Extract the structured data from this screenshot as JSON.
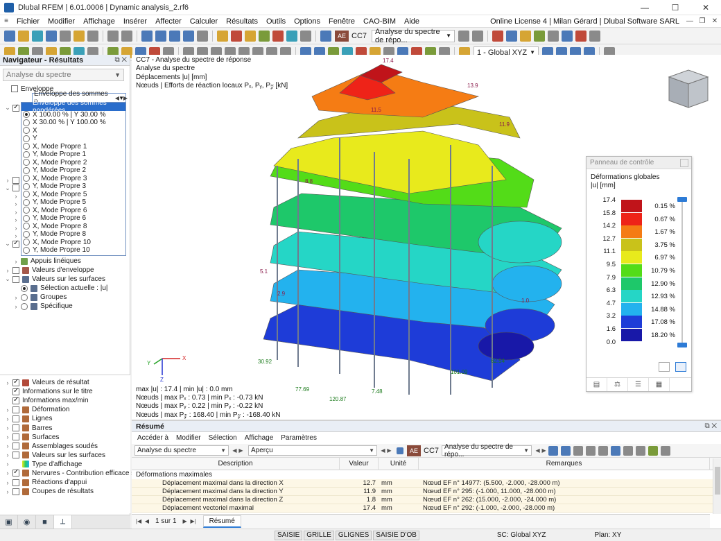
{
  "window": {
    "title": "Dlubal RFEM | 6.01.0006 | Dynamic analysis_2.rf6",
    "minimize": "—",
    "maximize": "☐",
    "close": "✕"
  },
  "menu": {
    "items": [
      "Fichier",
      "Modifier",
      "Affichage",
      "Insérer",
      "Affecter",
      "Calculer",
      "Résultats",
      "Outils",
      "Options",
      "Fenêtre",
      "CAO-BIM",
      "Aide"
    ],
    "license": "Online License 4 | Milan Gérard | Dlubal Software SARL"
  },
  "toolbar": {
    "lc_badge": "AE",
    "lc_code": "CC7",
    "lc_name": "Analyse du spectre de répo...",
    "view_combo": "1 - Global XYZ"
  },
  "navigator": {
    "title": "Navigateur - Résultats",
    "analysis_combo": "Analyse du spectre",
    "enveloppe_label": "Enveloppe",
    "enveloppe_dropdown": "Enveloppe des sommes p...",
    "dropdown_selected": "Enveloppe des sommes pondérées",
    "dropdown_items": [
      "X 100.00 % | Y 30.00 %",
      "X 30.00 % | Y 100.00 %",
      "X",
      "Y",
      "X, Mode Propre 1",
      "Y, Mode Propre 1",
      "X, Mode Propre 2",
      "Y, Mode Propre 2",
      "X, Mode Propre 3",
      "Y, Mode Propre 3",
      "X, Mode Propre 5",
      "Y, Mode Propre 5",
      "X, Mode Propre 6",
      "Y, Mode Propre 6",
      "X, Mode Propre 8",
      "Y, Mode Propre 8",
      "X, Mode Propre 10",
      "Y, Mode Propre 10"
    ],
    "tree_items": [
      "Appuis linéiques",
      "Valeurs d'enveloppe",
      "Valeurs sur les surfaces",
      "Sélection actuelle : |u|",
      "Groupes",
      "Spécifique"
    ],
    "bottom_items": [
      "Valeurs de résultat",
      "Informations sur le titre",
      "Informations max/min",
      "Déformation",
      "Lignes",
      "Barres",
      "Surfaces",
      "Assemblages soudés",
      "Valeurs sur les surfaces",
      "Type d'affichage",
      "Nervures - Contribution efficace sur ...",
      "Réactions d'appui",
      "Coupes de résultats"
    ],
    "tabs": [
      "camera-icon",
      "eye-icon",
      "video-icon",
      "axis-icon"
    ]
  },
  "viewport": {
    "info": [
      "CC7 - Analyse du spectre de réponse",
      "Analyse du spectre",
      "Déplacements |u| [mm]",
      "Nœuds | Efforts de réaction locaux Pₓ, Pᵧ, P𝓏 [kN]"
    ],
    "summary": [
      "max |u| : 17.4 | min |u| : 0.0 mm",
      "Nœuds | max Pₓ : 0.73 | min Pₓ : -0.73 kN",
      "Nœuds | max Pᵧ : 0.22 | min Pᵧ : -0.22 kN",
      "Nœuds | max P𝓏 : 168.40 | min P𝓏 : -168.40 kN"
    ],
    "labels_top": [
      "17.4",
      "13.9",
      "11.9",
      "11.5",
      "8.8",
      "5.1",
      "2.9",
      "1.0"
    ],
    "labels_reaction": [
      "30.92",
      "77.69",
      "120.87",
      "101.09",
      "62.54",
      "7.48"
    ],
    "axis": {
      "x": "X",
      "y": "Y",
      "z": "Z"
    }
  },
  "control_panel": {
    "title": "Panneau de contrôle",
    "subtitle_1": "Déformations globales",
    "subtitle_2": "|u| [mm]",
    "legend": [
      {
        "value": "17.4",
        "color": "#c0141a",
        "pct": "0.15 %"
      },
      {
        "value": "15.8",
        "color": "#ee2318",
        "pct": "0.67 %"
      },
      {
        "value": "14.2",
        "color": "#f57c14",
        "pct": "1.67 %"
      },
      {
        "value": "12.7",
        "color": "#c9c21a",
        "pct": "3.75 %"
      },
      {
        "value": "11.1",
        "color": "#e8ea1c",
        "pct": "6.97 %"
      },
      {
        "value": "9.5",
        "color": "#53dc18",
        "pct": "10.79 %"
      },
      {
        "value": "7.9",
        "color": "#1ec86a",
        "pct": "12.90 %"
      },
      {
        "value": "6.3",
        "color": "#25d6c6",
        "pct": "12.93 %"
      },
      {
        "value": "4.7",
        "color": "#23b2ee",
        "pct": "14.88 %"
      },
      {
        "value": "3.2",
        "color": "#1e3cd8",
        "pct": "17.08 %"
      },
      {
        "value": "1.6",
        "color": "#1818a8",
        "pct": "18.20 %"
      }
    ],
    "legend_min": "0.0"
  },
  "resume": {
    "title": "Résumé",
    "menu": [
      "Accéder à",
      "Modifier",
      "Sélection",
      "Affichage",
      "Paramètres"
    ],
    "combo_analysis": "Analyse du spectre",
    "combo_view": "Aperçu",
    "lc_badge": "AE",
    "lc_code": "CC7",
    "lc_name": "Analyse du spectre de répo...",
    "columns": [
      "Description",
      "Valeur",
      "Unité",
      "Remarques"
    ],
    "group": "Déformations maximales",
    "rows": [
      {
        "description": "Déplacement maximal dans la direction X",
        "value": "12.7",
        "unit": "mm",
        "remark": "Nœud EF n° 14977: (5.500, -2.000, -28.000 m)"
      },
      {
        "description": "Déplacement maximal dans la direction Y",
        "value": "11.9",
        "unit": "mm",
        "remark": "Nœud EF n° 295: (-1.000, 11.000, -28.000 m)"
      },
      {
        "description": "Déplacement maximal dans la direction Z",
        "value": "1.8",
        "unit": "mm",
        "remark": "Nœud EF n° 262: (15.000, -2.000, -24.000 m)"
      },
      {
        "description": "Déplacement vectoriel maximal",
        "value": "17.4",
        "unit": "mm",
        "remark": "Nœud EF n° 292: (-1.000, -2.000, -28.000 m)"
      }
    ],
    "pager": "1 sur 1",
    "sheet": "Résumé"
  },
  "statusbar": {
    "buttons": [
      "SAISIE",
      "GRILLE",
      "GLIGNES",
      "SAISIE D'OB"
    ],
    "cs": "SC: Global XYZ",
    "plane": "Plan: XY"
  }
}
